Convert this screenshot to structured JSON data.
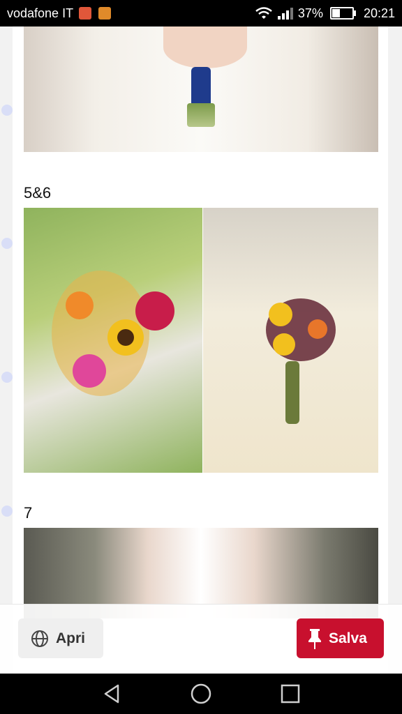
{
  "status_bar": {
    "carrier": "vodafone IT",
    "battery_percent_label": "37%",
    "battery_level": 0.37,
    "time": "20:21",
    "icons": [
      "email-notification-icon",
      "gift-notification-icon",
      "wifi-icon",
      "signal-icon",
      "battery-icon"
    ]
  },
  "content": {
    "sections": [
      {
        "label": "5&6"
      },
      {
        "label": "7"
      }
    ]
  },
  "actions": {
    "open_label": "Apri",
    "save_label": "Salva",
    "save_color": "#c8102e"
  },
  "nav": {
    "icons": [
      "back-icon",
      "home-icon",
      "recents-icon"
    ]
  }
}
